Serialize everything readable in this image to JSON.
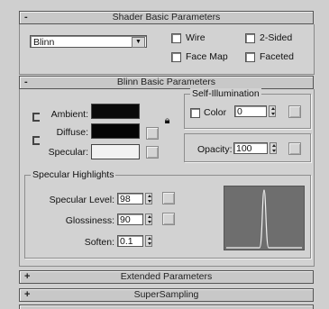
{
  "shader_basic": {
    "title": "Shader Basic Parameters",
    "toggle": "-",
    "shader_value": "Blinn",
    "wire": "Wire",
    "two_sided": "2-Sided",
    "face_map": "Face Map",
    "faceted": "Faceted"
  },
  "blinn_basic": {
    "title": "Blinn Basic Parameters",
    "toggle": "-",
    "ambient": "Ambient:",
    "diffuse": "Diffuse:",
    "specular": "Specular:",
    "ambient_color": "#0a0a0a",
    "diffuse_color": "#050505",
    "specular_color": "#f2f2f2",
    "lock_icon": "lock-icon",
    "self_illumination": {
      "title": "Self-Illumination",
      "color_label": "Color",
      "color_value": "0"
    },
    "opacity": {
      "label": "Opacity:",
      "value": "100"
    },
    "specular_highlights": {
      "title": "Specular Highlights",
      "level_label": "Specular Level:",
      "level_value": "98",
      "gloss_label": "Glossiness:",
      "gloss_value": "90",
      "soften_label": "Soften:",
      "soften_value": "0.1"
    }
  },
  "collapsed_rollouts": [
    {
      "toggle": "+",
      "title": "Extended Parameters"
    },
    {
      "toggle": "+",
      "title": "SuperSampling"
    }
  ]
}
